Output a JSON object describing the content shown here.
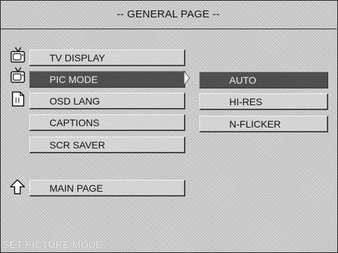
{
  "title": "-- GENERAL PAGE --",
  "menu": {
    "items": [
      {
        "label": "TV DISPLAY",
        "icon": "tv-icon"
      },
      {
        "label": "PIC MODE",
        "icon": "tv-icon",
        "selected": true
      },
      {
        "label": "OSD LANG",
        "icon": "document-icon"
      },
      {
        "label": "CAPTIONS"
      },
      {
        "label": "SCR SAVER"
      }
    ],
    "main_page": {
      "label": "MAIN PAGE",
      "icon": "up-arrow-icon"
    }
  },
  "submenu": {
    "options": [
      {
        "label": "AUTO",
        "selected": true
      },
      {
        "label": "HI-RES"
      },
      {
        "label": "N-FLICKER"
      }
    ]
  },
  "status_text": "SET PICTURE MODE",
  "colors": {
    "selected_bg": "#4a4a4a",
    "button_bg": "#d9d9d9",
    "border": "#222222"
  }
}
